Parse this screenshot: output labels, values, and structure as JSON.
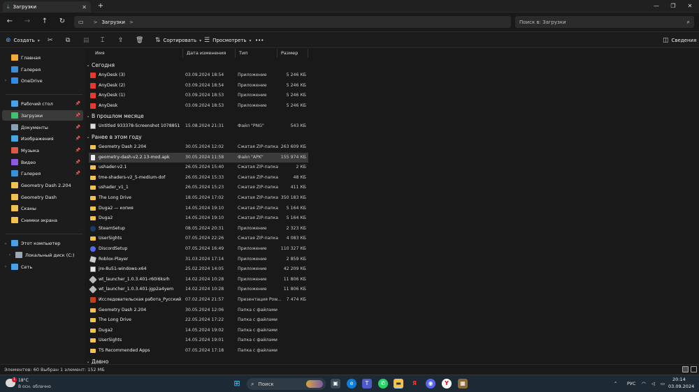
{
  "window": {
    "tab_title": "Загрузки",
    "new_tab_glyph": "+"
  },
  "nav": {
    "breadcrumb_chevron": ">",
    "address_segment": "Загрузки",
    "search_placeholder": "Поиск в: Загрузки"
  },
  "toolbar": {
    "create_label": "Создать",
    "sort_label": "Сортировать",
    "view_label": "Просмотреть",
    "more_label": "•••",
    "details_label": "Сведения"
  },
  "sidebar": {
    "items": [
      {
        "label": "Главная",
        "icon": "home-icon",
        "color": "#f0a93a",
        "pinned": false
      },
      {
        "label": "Галерея",
        "icon": "gallery-icon",
        "color": "#3b8fd6",
        "pinned": false
      },
      {
        "label": "OneDrive",
        "icon": "cloud-icon",
        "color": "#2f8ee8",
        "pinned": false,
        "expand": true
      },
      {
        "label": "Рабочий стол",
        "icon": "desktop-icon",
        "color": "#4aa0e6",
        "pinned": true
      },
      {
        "label": "Загрузки",
        "icon": "download-icon",
        "color": "#3ec46d",
        "pinned": true,
        "active": true
      },
      {
        "label": "Документы",
        "icon": "document-icon",
        "color": "#8aa1b5",
        "pinned": true
      },
      {
        "label": "Изображения",
        "icon": "image-icon",
        "color": "#46a7e0",
        "pinned": true
      },
      {
        "label": "Музыка",
        "icon": "music-icon",
        "color": "#e0584a",
        "pinned": true
      },
      {
        "label": "Видео",
        "icon": "video-icon",
        "color": "#8e5ae0",
        "pinned": true
      },
      {
        "label": "Галерея",
        "icon": "gallery-icon",
        "color": "#3b8fd6",
        "pinned": true
      },
      {
        "label": "Geometry Dash 2.204",
        "icon": "folder-icon",
        "color": "#f2c14e",
        "pinned": false
      },
      {
        "label": "Geometry Dash",
        "icon": "folder-icon",
        "color": "#f2c14e",
        "pinned": false
      },
      {
        "label": "Сканы",
        "icon": "folder-icon",
        "color": "#f2c14e",
        "pinned": false
      },
      {
        "label": "Снимки экрана",
        "icon": "folder-icon",
        "color": "#f2c14e",
        "pinned": false
      },
      {
        "label": "Этот компьютер",
        "icon": "computer-icon",
        "color": "#4aa0e6",
        "pinned": false,
        "expand": "open"
      },
      {
        "label": "Локальный диск (C:)",
        "icon": "drive-icon",
        "color": "#9aa8b5",
        "pinned": false,
        "expand": true,
        "indent": true
      },
      {
        "label": "Сеть",
        "icon": "network-icon",
        "color": "#4aa0e6",
        "pinned": false,
        "expand": true
      }
    ]
  },
  "columns": {
    "name": "Имя",
    "date": "Дата изменения",
    "type": "Тип",
    "size": "Размер"
  },
  "groups": [
    {
      "label": "Сегодня",
      "files": [
        {
          "name": "AnyDesk (3)",
          "date": "03.09.2024 18:54",
          "type": "Приложение",
          "size": "5 246 КБ",
          "icon": "app"
        },
        {
          "name": "AnyDesk (2)",
          "date": "03.09.2024 18:54",
          "type": "Приложение",
          "size": "5 246 КБ",
          "icon": "app"
        },
        {
          "name": "AnyDesk (1)",
          "date": "03.09.2024 18:53",
          "type": "Приложение",
          "size": "5 246 КБ",
          "icon": "app"
        },
        {
          "name": "AnyDesk",
          "date": "03.09.2024 18:53",
          "type": "Приложение",
          "size": "5 246 КБ",
          "icon": "app"
        }
      ]
    },
    {
      "label": "В прошлом месяце",
      "files": [
        {
          "name": "Untitled 933378-Screenshot 1078851",
          "date": "15.08.2024 21:31",
          "type": "Файл \"PNG\"",
          "size": "543 КБ",
          "icon": "img"
        }
      ]
    },
    {
      "label": "Ранее в этом году",
      "files": [
        {
          "name": "Geometry Dash 2.204",
          "date": "30.05.2024 12:02",
          "type": "Сжатая ZIP-папка",
          "size": "263 609 КБ",
          "icon": "zip"
        },
        {
          "name": "geometry-dash-v2.2.13-mod.apk",
          "date": "30.05.2024 11:58",
          "type": "Файл \"APK\"",
          "size": "155 974 КБ",
          "icon": "file",
          "selected": true
        },
        {
          "name": "ushader-v2.1",
          "date": "26.05.2024 15:40",
          "type": "Сжатая ZIP-папка",
          "size": "2 КБ",
          "icon": "zip"
        },
        {
          "name": "tme-shaders-v2_5-medium-dof",
          "date": "26.05.2024 15:33",
          "type": "Сжатая ZIP-папка",
          "size": "48 КБ",
          "icon": "zip"
        },
        {
          "name": "ushader_v1_1",
          "date": "26.05.2024 15:23",
          "type": "Сжатая ZIP-папка",
          "size": "411 КБ",
          "icon": "zip"
        },
        {
          "name": "The Long Drive",
          "date": "18.05.2024 17:02",
          "type": "Сжатая ZIP-папка",
          "size": "350 183 КБ",
          "icon": "zip"
        },
        {
          "name": "Duga2 — копия",
          "date": "14.05.2024 19:10",
          "type": "Сжатая ZIP-папка",
          "size": "5 164 КБ",
          "icon": "zip"
        },
        {
          "name": "Duga2",
          "date": "14.05.2024 19:10",
          "type": "Сжатая ZIP-папка",
          "size": "5 164 КБ",
          "icon": "zip"
        },
        {
          "name": "SteamSetup",
          "date": "08.05.2024 20:31",
          "type": "Приложение",
          "size": "2 323 КБ",
          "icon": "steam"
        },
        {
          "name": "UserSights",
          "date": "07.05.2024 22:26",
          "type": "Сжатая ZIP-папка",
          "size": "4 083 КБ",
          "icon": "zip"
        },
        {
          "name": "DiscordSetup",
          "date": "07.05.2024 16:49",
          "type": "Приложение",
          "size": "110 327 КБ",
          "icon": "discord"
        },
        {
          "name": "Roblox-Player",
          "date": "31.03.2024 17:14",
          "type": "Приложение",
          "size": "2 859 КБ",
          "icon": "roblox"
        },
        {
          "name": "jre-8u51-windows-x64",
          "date": "25.02.2024 14:05",
          "type": "Приложение",
          "size": "42 209 КБ",
          "icon": "java"
        },
        {
          "name": "wt_launcher_1.0.3.401-r60i6ksrh",
          "date": "14.02.2024 10:28",
          "type": "Приложение",
          "size": "11 806 КБ",
          "icon": "wt"
        },
        {
          "name": "wt_launcher_1.0.3.401-jgp2a4yem",
          "date": "14.02.2024 10:28",
          "type": "Приложение",
          "size": "11 806 КБ",
          "icon": "wt"
        },
        {
          "name": "Исследовательская работа_Русский б...",
          "date": "07.02.2024 21:57",
          "type": "Презентация Pow...",
          "size": "7 474 КБ",
          "icon": "ppt"
        },
        {
          "name": "Geometry Dash 2.204",
          "date": "30.05.2024 12:06",
          "type": "Папка с файлами",
          "size": "",
          "icon": "folder"
        },
        {
          "name": "The Long Drive",
          "date": "22.05.2024 17:22",
          "type": "Папка с файлами",
          "size": "",
          "icon": "folder"
        },
        {
          "name": "Duga2",
          "date": "14.05.2024 19:02",
          "type": "Папка с файлами",
          "size": "",
          "icon": "folder"
        },
        {
          "name": "UserSights",
          "date": "14.05.2024 19:01",
          "type": "Папка с файлами",
          "size": "",
          "icon": "folder"
        },
        {
          "name": "TS Recommended Apps",
          "date": "07.05.2024 17:18",
          "type": "Папка с файлами",
          "size": "",
          "icon": "folder"
        }
      ]
    },
    {
      "label": "Давно",
      "files": []
    }
  ],
  "status": {
    "count": "Элементов: 60",
    "selection": "Выбран 1 элемент: 152 МБ"
  },
  "taskbar": {
    "weather_temp": "18°C",
    "weather_desc": "В осн. облачно",
    "weather_badge": "1",
    "search_label": "Поиск",
    "language": "РУС",
    "time": "20:14",
    "date": "03.09.2024"
  }
}
